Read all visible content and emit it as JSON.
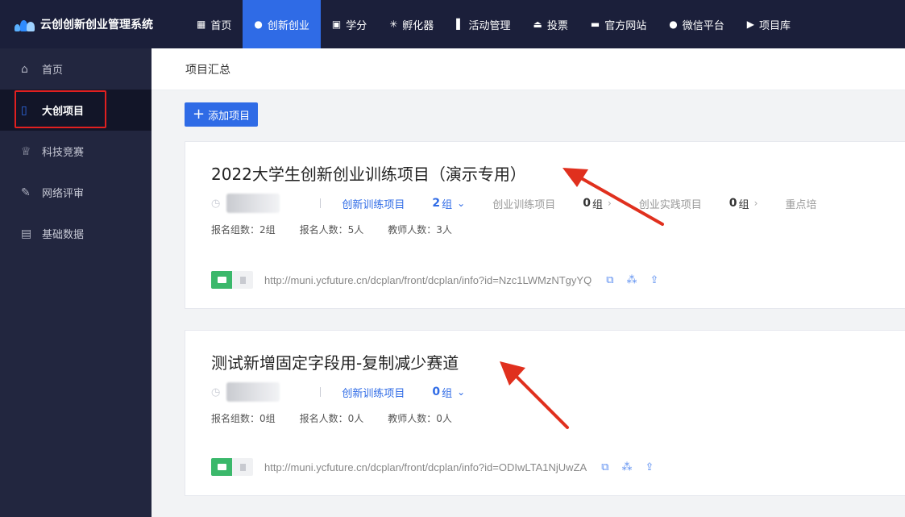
{
  "app": {
    "title": "云创创新创业管理系统"
  },
  "nav": [
    {
      "label": "首页",
      "icon": "grid-icon",
      "active": false
    },
    {
      "label": "创新创业",
      "icon": "bulb-icon",
      "active": true
    },
    {
      "label": "学分",
      "icon": "image-icon",
      "active": false
    },
    {
      "label": "孵化器",
      "icon": "sparkle-icon",
      "active": false
    },
    {
      "label": "活动管理",
      "icon": "flag-icon",
      "active": false
    },
    {
      "label": "投票",
      "icon": "ballot-icon",
      "active": false
    },
    {
      "label": "官方网站",
      "icon": "monitor-icon",
      "active": false
    },
    {
      "label": "微信平台",
      "icon": "chat-icon",
      "active": false
    },
    {
      "label": "项目库",
      "icon": "play-box-icon",
      "active": false
    }
  ],
  "sidebar": {
    "items": [
      {
        "label": "首页",
        "icon": "home-icon",
        "active": false
      },
      {
        "label": "大创项目",
        "icon": "project-icon",
        "active": true
      },
      {
        "label": "科技竞赛",
        "icon": "trophy-icon",
        "active": false
      },
      {
        "label": "网络评审",
        "icon": "pen-icon",
        "active": false
      },
      {
        "label": "基础数据",
        "icon": "data-icon",
        "active": false
      }
    ]
  },
  "page": {
    "breadcrumb": "项目汇总",
    "add_button": "添加项目"
  },
  "projects": [
    {
      "title": "2022大学生创新创业训练项目（演示专用）",
      "tracks": [
        {
          "name": "创新训练项目",
          "count": "2",
          "unit": "组",
          "active": true
        },
        {
          "name": "创业训练项目",
          "count": "0",
          "unit": "组",
          "active": false
        },
        {
          "name": "创业实践项目",
          "count": "0",
          "unit": "组",
          "active": false
        },
        {
          "name": "重点培",
          "count": "",
          "unit": "",
          "active": false
        }
      ],
      "stats": {
        "groups": "报名组数：2组",
        "people": "报名人数：5人",
        "teachers": "教师人数：3人"
      },
      "url": "http://muni.ycfuture.cn/dcplan/front/dcplan/info?id=Nzc1LWMzNTgyYQ"
    },
    {
      "title": "测试新增固定字段用-复制减少赛道",
      "tracks": [
        {
          "name": "创新训练项目",
          "count": "0",
          "unit": "组",
          "active": true
        }
      ],
      "stats": {
        "groups": "报名组数：0组",
        "people": "报名人数：0人",
        "teachers": "教师人数：0人"
      },
      "url": "http://muni.ycfuture.cn/dcplan/front/dcplan/info?id=ODIwLTA1NjUwZA"
    }
  ],
  "colors": {
    "accent": "#2f6be6",
    "nav_bg": "#1b1f3a",
    "sidebar_bg": "#22263f",
    "highlight": "#e02020",
    "arrow": "#e0301e",
    "toggle_on": "#3bb86b"
  }
}
